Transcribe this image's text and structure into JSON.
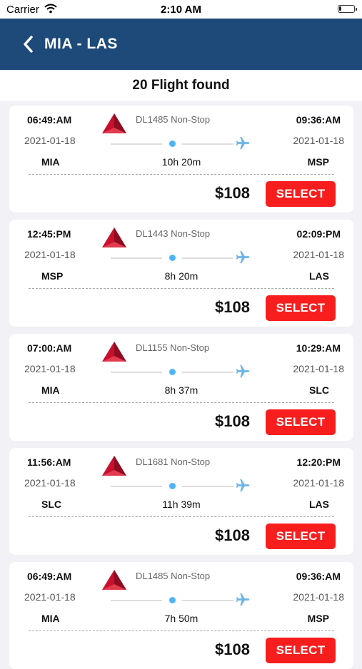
{
  "status_bar": {
    "carrier": "Carrier",
    "time": "2:10 AM",
    "wifi_icon": "wifi-icon",
    "battery_icon": "battery-icon"
  },
  "header": {
    "route": "MIA -  LAS",
    "back_icon": "chevron-left-icon",
    "background": "#1e4a7a"
  },
  "results": {
    "text": "20 Flight found"
  },
  "colors": {
    "select_button": "#f81e1e",
    "progress_dot": "#4fb3f6",
    "plane_icon": "#6cb4e8",
    "airline_logo": "#c8102e"
  },
  "flights": [
    {
      "dep_time": "06:49:AM",
      "arr_time": "09:36:AM",
      "dep_date": "2021-01-18",
      "arr_date": "2021-01-18",
      "dep_code": "MIA",
      "arr_code": "MSP",
      "flight_info": "DL1485 Non-Stop",
      "duration": "10h 20m",
      "price": "$108",
      "select_label": "SELECT"
    },
    {
      "dep_time": "12:45:PM",
      "arr_time": "02:09:PM",
      "dep_date": "2021-01-18",
      "arr_date": "2021-01-18",
      "dep_code": "MSP",
      "arr_code": "LAS",
      "flight_info": "DL1443 Non-Stop",
      "duration": "8h 20m",
      "price": "$108",
      "select_label": "SELECT"
    },
    {
      "dep_time": "07:00:AM",
      "arr_time": "10:29:AM",
      "dep_date": "2021-01-18",
      "arr_date": "2021-01-18",
      "dep_code": "MIA",
      "arr_code": "SLC",
      "flight_info": "DL1155 Non-Stop",
      "duration": "8h 37m",
      "price": "$108",
      "select_label": "SELECT"
    },
    {
      "dep_time": "11:56:AM",
      "arr_time": "12:20:PM",
      "dep_date": "2021-01-18",
      "arr_date": "2021-01-18",
      "dep_code": "SLC",
      "arr_code": "LAS",
      "flight_info": "DL1681 Non-Stop",
      "duration": "11h 39m",
      "price": "$108",
      "select_label": "SELECT"
    },
    {
      "dep_time": "06:49:AM",
      "arr_time": "09:36:AM",
      "dep_date": "2021-01-18",
      "arr_date": "2021-01-18",
      "dep_code": "MIA",
      "arr_code": "MSP",
      "flight_info": "DL1485 Non-Stop",
      "duration": "7h 50m",
      "price": "$108",
      "select_label": "SELECT"
    }
  ]
}
